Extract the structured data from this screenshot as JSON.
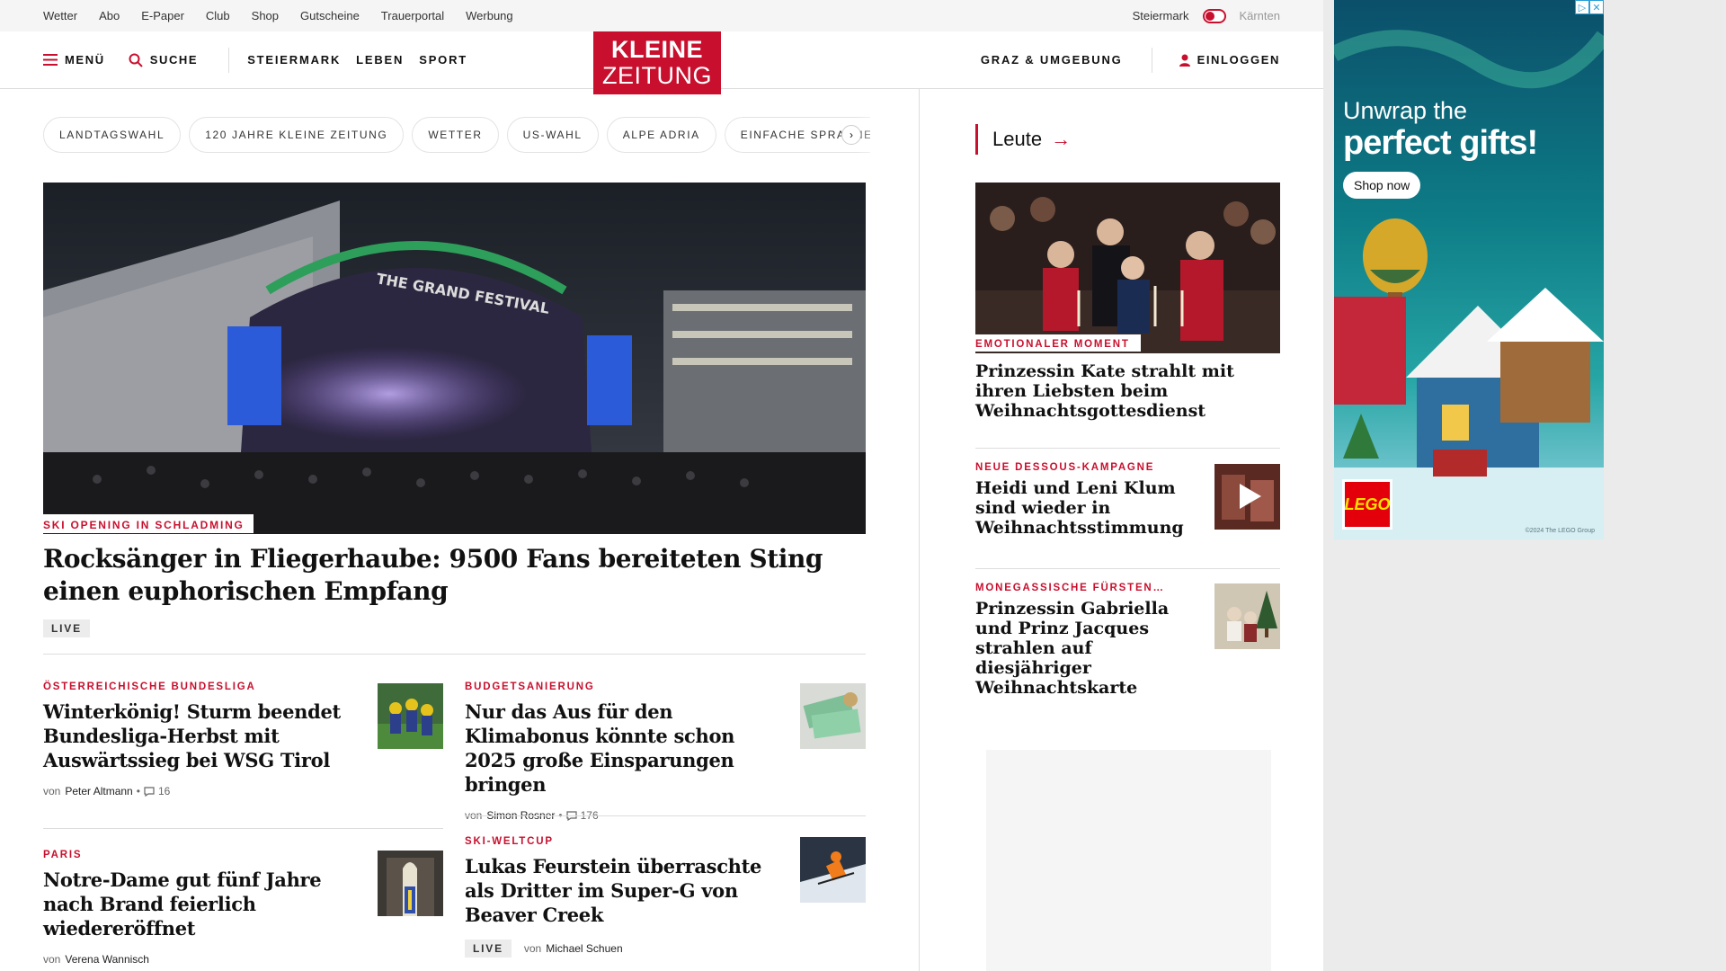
{
  "utility_bar": {
    "links": [
      "Wetter",
      "Abo",
      "E-Paper",
      "Club",
      "Shop",
      "Gutscheine",
      "Trauerportal",
      "Werbung"
    ],
    "region_active": "Steiermark",
    "region_inactive": "Kärnten"
  },
  "header": {
    "menu_label": "MENÜ",
    "search_label": "SUCHE",
    "nav_links": [
      "STEIERMARK",
      "LEBEN",
      "SPORT"
    ],
    "logo_line1": "KLEINE",
    "logo_line2": "ZEITUNG",
    "region_link": "GRAZ & UMGEBUNG",
    "login_label": "EINLOGGEN",
    "brand_color": "#c8102e"
  },
  "tags": [
    "LANDTAGSWAHL",
    "120 JAHRE KLEINE ZEITUNG",
    "WETTER",
    "US-WAHL",
    "ALPE ADRIA",
    "EINFACHE SPRACHE"
  ],
  "hero": {
    "kicker": "SKI OPENING IN SCHLADMING",
    "title": "Rocksänger in Fliegerhaube: 9500 Fans bereiteten Sting einen euphorischen Empfang",
    "badge": "LIVE",
    "stage_text": "THE GRAND FESTIVAL"
  },
  "articles": [
    {
      "kicker": "ÖSTERREICHISCHE BUNDESLIGA",
      "title": "Winterkönig! Sturm beendet Bundesliga-Herbst mit Auswärtssieg bei WSG Tirol",
      "by": "von",
      "author": "Peter Altmann",
      "comments": "16"
    },
    {
      "kicker": "BUDGETSANIERUNG",
      "title": "Nur das Aus für den Klimabonus könnte schon 2025 große Einsparungen bringen",
      "by": "von",
      "author": "Simon Rosner",
      "comments": "176"
    },
    {
      "kicker": "PARIS",
      "title": "Notre-Dame gut fünf Jahre nach Brand feierlich wiedereröffnet",
      "by": "von",
      "author": "Verena Wannisch"
    },
    {
      "kicker": "SKI-WELTCUP",
      "title": "Lukas Feurstein überraschte als Dritter im Super-G von Beaver Creek",
      "badge": "LIVE",
      "by": "von",
      "author": "Michael Schuen"
    }
  ],
  "sidebar": {
    "heading": "Leute",
    "lead": {
      "kicker": "EMOTIONALER MOMENT",
      "title": "Prinzessin Kate strahlt mit ihren Liebsten beim Weihnachtsgottesdienst"
    },
    "items": [
      {
        "kicker": "NEUE DESSOUS-KAMPAGNE",
        "title": "Heidi und Leni Klum sind wieder in Weihnachtsstimmung"
      },
      {
        "kicker": "MONEGASSISCHE FÜRSTEN…",
        "title": "Prinzessin Gabriella und Prinz Jacques strahlen auf diesjähriger Weihnachtskarte"
      }
    ]
  },
  "ad": {
    "headline1": "Unwrap the",
    "headline2": "perfect gifts!",
    "cta": "Shop now",
    "brand": "LEGO",
    "copyright": "©2024 The LEGO Group"
  }
}
